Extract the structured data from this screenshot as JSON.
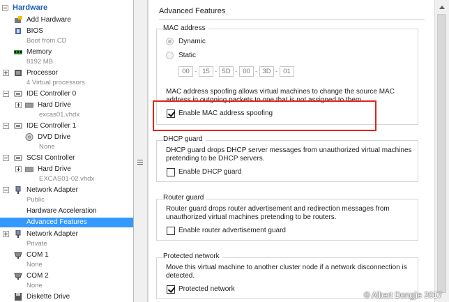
{
  "tree": {
    "header": "Hardware",
    "items": [
      {
        "label": "Add Hardware"
      },
      {
        "label": "BIOS",
        "sub": "Boot from CD"
      },
      {
        "label": "Memory",
        "sub": "8192 MB"
      },
      {
        "label": "Processor",
        "sub": "4 Virtual processors"
      },
      {
        "label": "IDE Controller 0"
      },
      {
        "label": "Hard Drive",
        "sub": "excas01.vhdx"
      },
      {
        "label": "IDE Controller 1"
      },
      {
        "label": "DVD Drive",
        "sub": "None"
      },
      {
        "label": "SCSI Controller"
      },
      {
        "label": "Hard Drive",
        "sub": "EXCAS01-02.vhdx"
      },
      {
        "label": "Network Adapter",
        "sub": "Public"
      },
      {
        "label": "Hardware Acceleration"
      },
      {
        "label": "Advanced Features"
      },
      {
        "label": "Network Adapter",
        "sub": "Private"
      },
      {
        "label": "COM 1",
        "sub": "None"
      },
      {
        "label": "COM 2",
        "sub": "None"
      },
      {
        "label": "Diskette Drive"
      }
    ]
  },
  "content": {
    "title": "Advanced Features",
    "mac_group": {
      "title": "MAC address",
      "dynamic_label": "Dynamic",
      "static_label": "Static",
      "mac_parts": [
        "00",
        "15",
        "5D",
        "00",
        "3D",
        "01"
      ],
      "spoofing_description": "MAC address spoofing allows virtual machines to change the source MAC address in outgoing packets to one that is not assigned to them.",
      "spoofing_checkbox": "Enable MAC address spoofing",
      "spoofing_checked": true
    },
    "dhcp_group": {
      "title": "DHCP guard",
      "description": "DHCP guard drops DHCP server messages from unauthorized virtual machines pretending to be DHCP servers.",
      "checkbox": "Enable DHCP guard",
      "checked": false
    },
    "router_group": {
      "title": "Router guard",
      "description": "Router guard drops router advertisement and redirection messages from unauthorized virtual machines pretending to be routers.",
      "checkbox": "Enable router advertisement guard",
      "checked": false
    },
    "protected_group": {
      "title": "Protected network",
      "description": "Move this virtual machine to another cluster node if a network disconnection is detected.",
      "checkbox": "Protected network",
      "checked": true
    }
  },
  "watermark": "© Albert Dongjie 2017",
  "colors": {
    "selection": "#3399ff",
    "highlight": "#e2231a",
    "header": "#1a5fb4"
  }
}
